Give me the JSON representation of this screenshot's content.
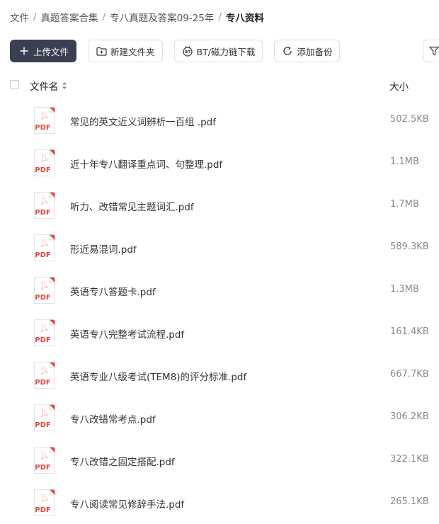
{
  "breadcrumb": {
    "items": [
      "文件",
      "真题答案合集",
      "专八真题及答案09-25年"
    ],
    "separator": "/",
    "current": "专八资料"
  },
  "toolbar": {
    "upload_label": "上传文件",
    "new_folder_label": "新建文件夹",
    "bt_label": "BT/磁力链下载",
    "backup_label": "添加备份"
  },
  "table": {
    "col_name": "文件名",
    "col_size": "大小"
  },
  "files": [
    {
      "name": "常见的英文近义词辨析一百组 .pdf",
      "size": "502.5KB",
      "icon_label": "PDF"
    },
    {
      "name": "近十年专八翻译重点词、句整理.pdf",
      "size": "1.1MB",
      "icon_label": "PDF"
    },
    {
      "name": "听力、改错常见主题词汇.pdf",
      "size": "1.7MB",
      "icon_label": "PDF"
    },
    {
      "name": "形近易混词.pdf",
      "size": "589.3KB",
      "icon_label": "PDF"
    },
    {
      "name": "英语专八答题卡.pdf",
      "size": "1.3MB",
      "icon_label": "PDF"
    },
    {
      "name": "英语专八完整考试流程.pdf",
      "size": "161.4KB",
      "icon_label": "PDF"
    },
    {
      "name": "英语专业八级考试(TEM8)的评分标准.pdf",
      "size": "667.7KB",
      "icon_label": "PDF"
    },
    {
      "name": "专八改错常考点.pdf",
      "size": "306.2KB",
      "icon_label": "PDF"
    },
    {
      "name": "专八改错之固定搭配.pdf",
      "size": "322.1KB",
      "icon_label": "PDF"
    },
    {
      "name": "专八阅读常见修辞手法.pdf",
      "size": "265.1KB",
      "icon_label": "PDF"
    }
  ],
  "icons": {
    "upload": "plus-icon",
    "new_folder": "folder-plus-icon",
    "bt": "bt-magnet-icon",
    "backup": "refresh-icon",
    "filter": "filter-icon",
    "sort": "sort-icon",
    "file": "pdf-file-icon"
  },
  "colors": {
    "primary_button": "#3a3f51",
    "pdf_red": "#e04a3f",
    "size_text": "#8a8a8a"
  }
}
